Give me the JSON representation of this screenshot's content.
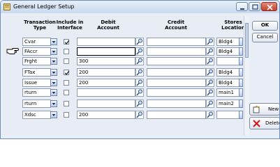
{
  "window": {
    "title": "General Ledger Setup"
  },
  "headers": {
    "type_line1": "Transaction",
    "type_line2": "Type",
    "iface_line1": "Include in",
    "iface_line2": "Interface",
    "debit_line1": "Debit",
    "debit_line2": "Account",
    "credit_line1": "Credit",
    "credit_line2": "Account",
    "stores_line1": "Stores",
    "stores_line2": "Location"
  },
  "rows": [
    {
      "type": "Cvar",
      "include": true,
      "debit": "",
      "credit": "",
      "store": "Bldg4"
    },
    {
      "type": "FAccr",
      "include": false,
      "debit": "",
      "credit": "",
      "store": "Bldg4"
    },
    {
      "type": "Frght",
      "include": false,
      "debit": "300",
      "credit": "",
      "store": ""
    },
    {
      "type": "FTax",
      "include": true,
      "debit": "200",
      "credit": "",
      "store": "Bldg4"
    },
    {
      "type": "Issue",
      "include": false,
      "debit": "200",
      "credit": "",
      "store": "Bldg4"
    },
    {
      "type": "rturn",
      "include": false,
      "debit": "",
      "credit": "",
      "store": "main1"
    },
    {
      "type": "rturn",
      "include": false,
      "debit": "",
      "credit": "",
      "store": "main2"
    },
    {
      "type": "Xdsc",
      "include": false,
      "debit": "200",
      "credit": "",
      "store": ""
    }
  ],
  "buttons": {
    "ok": "OK",
    "cancel": "Cancel",
    "new": "New",
    "delete": "Delete"
  },
  "icons": {
    "pointer_hand": "pointing-hand-icon",
    "lookup": "lookup-icon",
    "new": "new-document-icon",
    "delete": "delete-x-icon"
  },
  "colors": {
    "titlebar": "#c9d9ee",
    "close_button": "#c0402e",
    "grid_bg": "#e8edf5"
  }
}
